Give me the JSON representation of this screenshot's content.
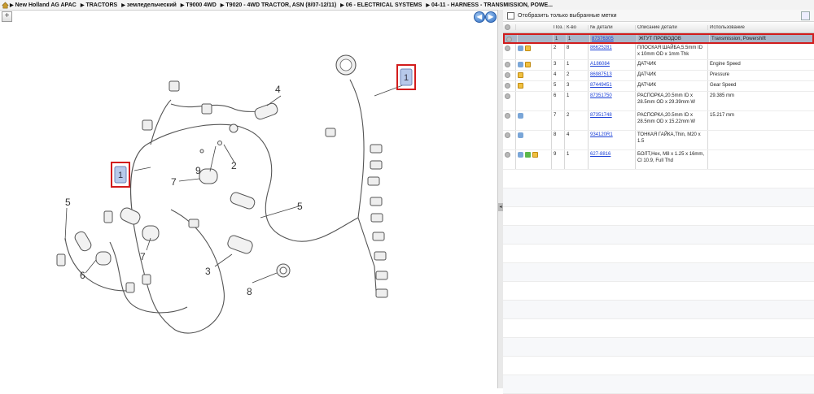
{
  "breadcrumb": [
    "New Holland AG APAC",
    "TRACTORS",
    "земледельческий",
    "T9000 4WD",
    "T9020 - 4WD TRACTOR, ASN (8/07-12/11)",
    "06 - ELECTRICAL SYSTEMS",
    "04-11 - HARNESS - TRANSMISSION, POWE..."
  ],
  "toolbar": {
    "plus_symbol": "+",
    "back_symbol": "◀",
    "forward_symbol": "▶"
  },
  "panel": {
    "filter_label": "Отобразить только выбранные метки"
  },
  "grid": {
    "headers": [
      "",
      "Поз.",
      "К-во",
      "№ детали",
      "Описание детали",
      "Использование"
    ],
    "rows": [
      {
        "pos": "1",
        "qty": "1",
        "part": "87376305",
        "desc": "ЖГУТ ПРОВОДОВ",
        "usage": "Transmission, Powershift",
        "icons": [
          "grey"
        ],
        "selected": true
      },
      {
        "pos": "2",
        "qty": "8",
        "part": "86625281",
        "desc": "ПЛОСКАЯ ШАЙБА,5.5mm ID x 10mm OD x 1mm Thk",
        "usage": "",
        "icons": [
          "grey",
          "info",
          "box"
        ]
      },
      {
        "pos": "3",
        "qty": "1",
        "part": "A186084",
        "desc": "ДАТЧИК",
        "usage": "Engine Speed",
        "icons": [
          "grey",
          "info",
          "box"
        ]
      },
      {
        "pos": "4",
        "qty": "2",
        "part": "86987513",
        "desc": "ДАТЧИК",
        "usage": "Pressure",
        "icons": [
          "grey",
          "box"
        ]
      },
      {
        "pos": "5",
        "qty": "3",
        "part": "87449451",
        "desc": "ДАТЧИК",
        "usage": "Gear Speed",
        "icons": [
          "grey",
          "box"
        ]
      },
      {
        "pos": "6",
        "qty": "1",
        "part": "87351750",
        "desc": "РАСПОРКА,20.5mm ID x 28.5mm OD x 29.39mm W",
        "usage": "29.385 mm",
        "icons": [
          "grey"
        ]
      },
      {
        "pos": "7",
        "qty": "2",
        "part": "87351748",
        "desc": "РАСПОРКА,20.5mm ID x 28.5mm OD x 15.22mm W",
        "usage": "15.217 mm",
        "icons": [
          "grey",
          "info"
        ]
      },
      {
        "pos": "8",
        "qty": "4",
        "part": "934120R1",
        "desc": "ТОНКАЯ ГАЙКА,Thin, M20 x 1.5",
        "usage": "",
        "icons": [
          "grey",
          "info"
        ]
      },
      {
        "pos": "9",
        "qty": "1",
        "part": "627-8816",
        "desc": "БОЛТ,Hex, M8 x 1.25 x 16mm, Cl 10.9, Full Thd",
        "usage": "",
        "icons": [
          "grey",
          "info",
          "green",
          "box"
        ]
      }
    ]
  },
  "diagram": {
    "callout_labels": [
      "1",
      "1"
    ],
    "part_labels": [
      "4",
      "5",
      "5",
      "7",
      "7",
      "9",
      "2",
      "6",
      "3",
      "8"
    ]
  }
}
